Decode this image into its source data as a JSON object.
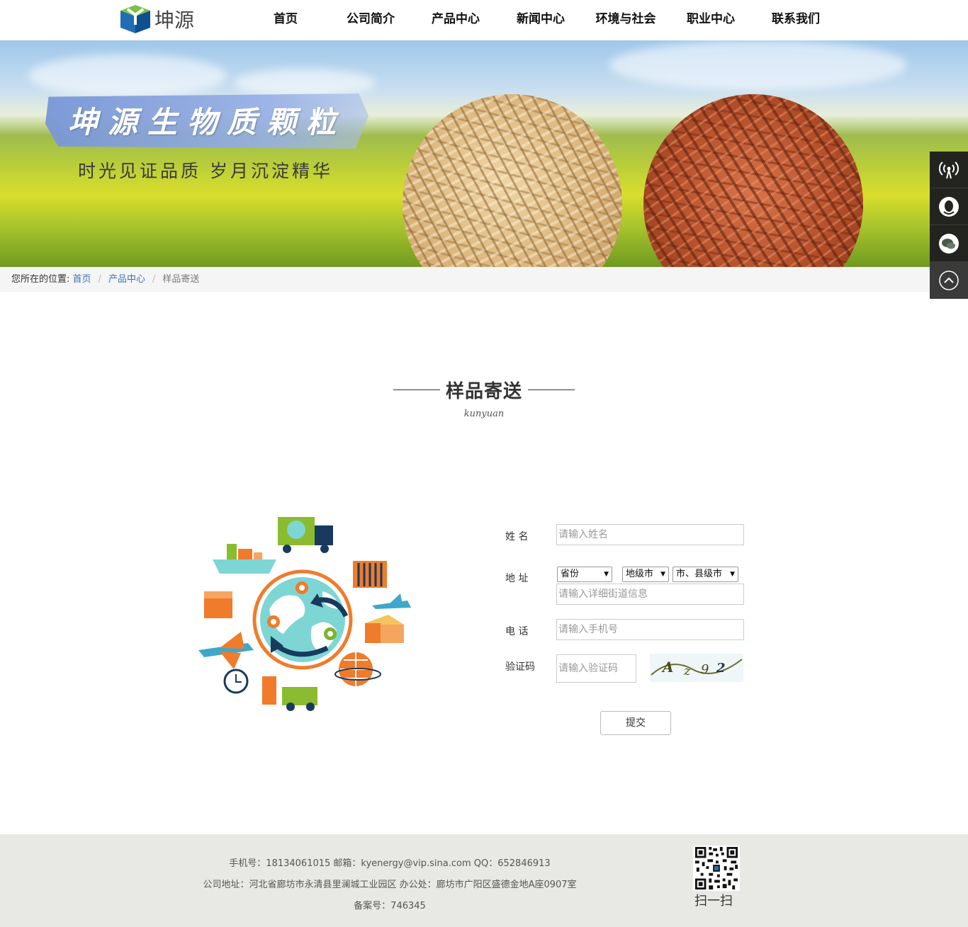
{
  "header": {
    "logo_text": "坤源",
    "nav": [
      "首页",
      "公司简介",
      "产品中心",
      "新闻中心",
      "环境与社会",
      "职业中心",
      "联系我们"
    ]
  },
  "banner": {
    "title": "坤源生物质颗粒",
    "slogan": "时光见证品质  岁月沉淀精华"
  },
  "breadcrumb": {
    "prefix": "您所在的位置:",
    "home": "首页",
    "products": "产品中心",
    "current": "样品寄送"
  },
  "section": {
    "title": "样品寄送",
    "subtitle": "kunyuan"
  },
  "form": {
    "name_label": "姓    名",
    "name_placeholder": "请输入姓名",
    "address_label": "地    址",
    "province": "省份",
    "city": "地级市",
    "county": "市、县级市",
    "street_placeholder": "请输入详细街道信息",
    "phone_label": "电    话",
    "phone_placeholder": "请输入手机号",
    "code_label": "验证码",
    "code_placeholder": "请输入验证码",
    "submit": "提交"
  },
  "footer": {
    "line1": "手机号：18134061015    邮箱：kyenergy@vip.sina.com    QQ：652846913",
    "line2": "公司地址：河北省廊坊市永清县里澜城工业园区    办公处：廊坊市广阳区盛德金地A座0907室",
    "line3": "备案号：746345",
    "qr_label": "扫一扫"
  },
  "colors": {
    "link": "#3a74b8",
    "sidebar": "#23231f",
    "footer_bg": "#e8e8e4"
  }
}
